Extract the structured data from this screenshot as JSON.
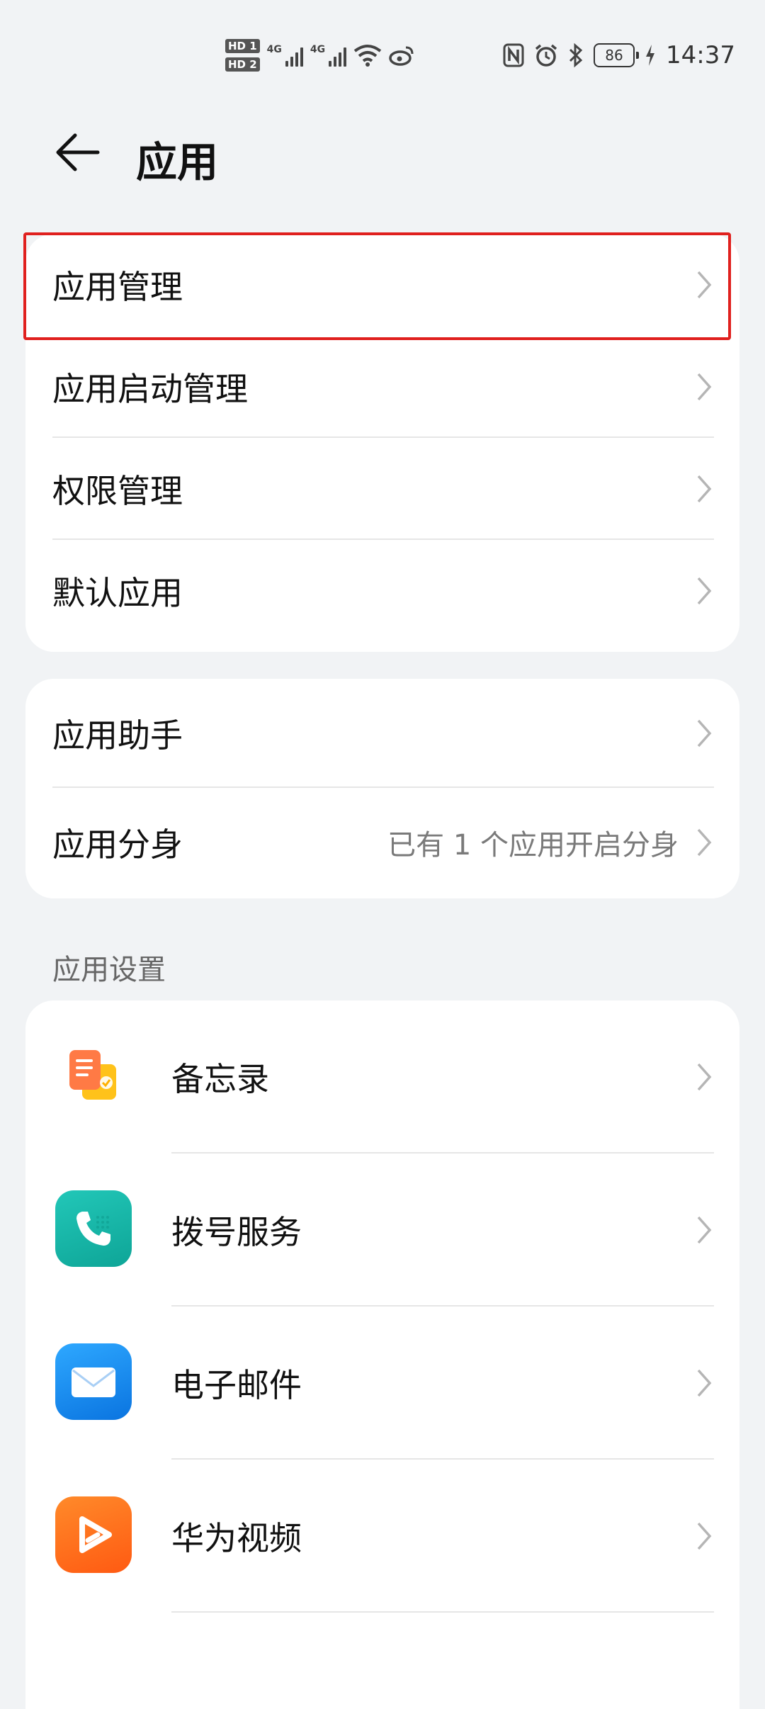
{
  "status_bar": {
    "hd1": "HD 1",
    "hd2": "HD 2",
    "net1": "4G",
    "net2": "4G",
    "battery": "86",
    "time": "14:37",
    "icons": [
      "signal-icon",
      "wifi-icon",
      "weibo-icon",
      "nfc-icon",
      "alarm-icon",
      "bluetooth-icon",
      "charging-icon"
    ]
  },
  "header": {
    "title": "应用",
    "back_icon": "back-arrow-icon"
  },
  "group1": [
    {
      "label": "应用管理",
      "highlighted": true
    },
    {
      "label": "应用启动管理"
    },
    {
      "label": "权限管理"
    },
    {
      "label": "默认应用"
    }
  ],
  "group2": [
    {
      "label": "应用助手",
      "value": ""
    },
    {
      "label": "应用分身",
      "value": "已有 1 个应用开启分身"
    }
  ],
  "app_settings": {
    "section_title": "应用设置",
    "apps": [
      {
        "label": "备忘录",
        "icon": "notepad-icon",
        "color": "#f5a623"
      },
      {
        "label": "拨号服务",
        "icon": "phone-icon",
        "color": "#14b8a6"
      },
      {
        "label": "电子邮件",
        "icon": "mail-icon",
        "color": "#1a8cf0"
      },
      {
        "label": "华为视频",
        "icon": "video-play-icon",
        "color": "#ff6a1a"
      }
    ]
  },
  "colors": {
    "background": "#f1f3f5",
    "highlight_border": "#e0201e",
    "secondary_text": "#7a7a7a"
  }
}
